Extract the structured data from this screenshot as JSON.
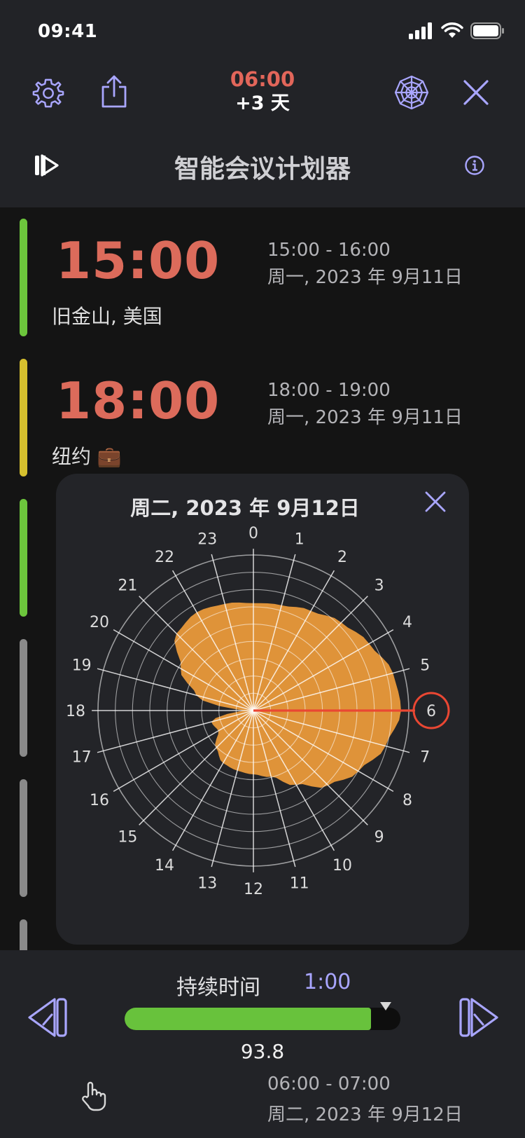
{
  "status": {
    "time": "09:41"
  },
  "header": {
    "target_time": "06:00",
    "day_offset": "+3 天",
    "title": "智能会议计划器"
  },
  "meetings": [
    {
      "time": "15:00",
      "city": "旧金山, 美国",
      "range": "15:00 - 16:00",
      "date": "周一, 2023 年 9月11日",
      "bar_color": "#6cc63c"
    },
    {
      "time": "18:00",
      "city": "纽约 💼",
      "range": "18:00 - 19:00",
      "date": "周一, 2023 年 9月11日",
      "bar_color": "#d6c02e"
    }
  ],
  "popup": {
    "date": "周二, 2023 年 9月12日",
    "hour_labels": [
      "0",
      "1",
      "2",
      "3",
      "4",
      "5",
      "6",
      "7",
      "8",
      "9",
      "10",
      "11",
      "12",
      "13",
      "14",
      "15",
      "16",
      "17",
      "18",
      "19",
      "20",
      "21",
      "22",
      "23"
    ],
    "selected_hour": 6,
    "fill_color": "#e5973a",
    "highlight_color": "#ea4733"
  },
  "duration": {
    "label": "持续时间",
    "value": "1:00",
    "score": "93.8",
    "fill_fraction": 0.93
  },
  "peek": {
    "range": "06:00 - 07:00",
    "date": "周二, 2023 年 9月12日"
  },
  "colors": {
    "accent": "#a9a6ff",
    "time_red": "#dc6b5b",
    "green": "#68c23c",
    "gray_bar": "#8a8a8a"
  }
}
